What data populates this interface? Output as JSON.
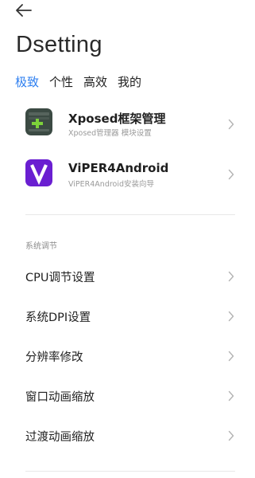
{
  "header": {
    "title": "Dsetting"
  },
  "tabs": [
    {
      "label": "极致",
      "active": true
    },
    {
      "label": "个性",
      "active": false
    },
    {
      "label": "高效",
      "active": false
    },
    {
      "label": "我的",
      "active": false
    }
  ],
  "apps": [
    {
      "title": "Xposed框架管理",
      "subtitle": "Xposed管理器 模块设置",
      "icon": "xposed-icon"
    },
    {
      "title": "ViPER4Android",
      "subtitle": "ViPER4Android安装向导",
      "icon": "viper-icon"
    }
  ],
  "section": {
    "header": "系统调节",
    "items": [
      {
        "label": "CPU调节设置"
      },
      {
        "label": "系统DPI设置"
      },
      {
        "label": "分辨率修改"
      },
      {
        "label": "窗口动画缩放"
      },
      {
        "label": "过渡动画缩放"
      }
    ]
  },
  "colors": {
    "accent": "#2d7ff0",
    "viper_purple": "#6a1fd1",
    "xposed_dark": "#3b4a43",
    "xposed_green": "#7dd13a"
  }
}
